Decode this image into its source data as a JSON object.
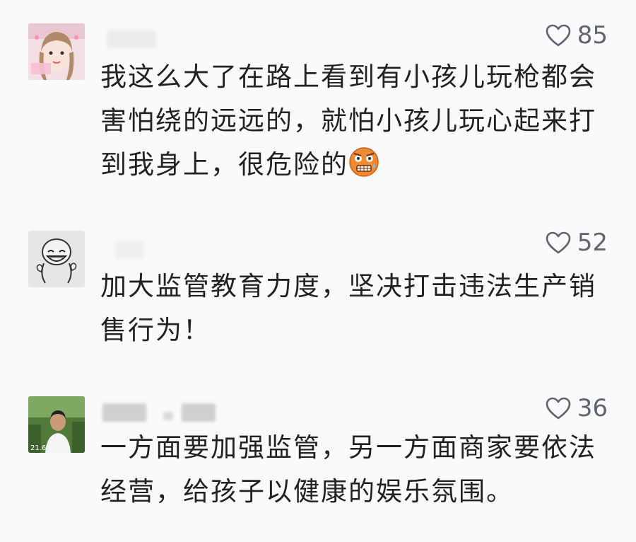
{
  "comments": [
    {
      "likes": "85",
      "text": "我这么大了在路上看到有小孩儿玩枪都会害怕绕的远远的，就怕小孩儿玩心起来打到我身上，很危险的",
      "emoji_icon": "scared-face-emoji"
    },
    {
      "likes": "52",
      "text": "加大监管教育力度，坚决打击违法生产销售行为！"
    },
    {
      "likes": "36",
      "text": "一方面要加强监管，另一方面商家要依法经营，给孩子以健康的娱乐氛围。"
    }
  ],
  "colors": {
    "background": "#fafafa",
    "text": "#222222",
    "like_icon": "#5f6570"
  }
}
